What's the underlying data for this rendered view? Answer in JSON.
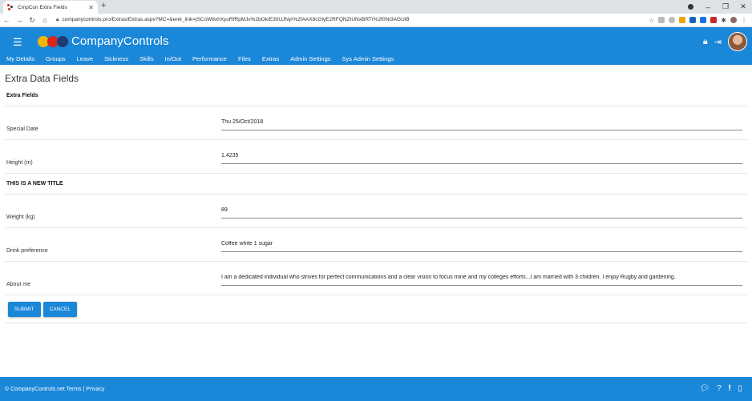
{
  "browser": {
    "tab_title": "CmpCon Extra Fields",
    "url": "companycontrols.pro/Extras/Extras.aspx?MC=&eret_link=jSCoW8xhXyuRfRpMJv%2bOk/E30UJNyr%2fAAX8cGlyE2RFQNZIUNxBRTr%2f0NI3AGUiB",
    "new_tab_symbol": "+",
    "icons": [
      "back-icon",
      "forward-icon",
      "reload-icon",
      "home-icon",
      "lock-icon",
      "star-icon",
      "profile-icon"
    ]
  },
  "app": {
    "brand": "CompanyControls",
    "menu": [
      "My Details",
      "Groups",
      "Leave",
      "Sickness",
      "Skills",
      "In/Out",
      "Performance",
      "Files",
      "Extras",
      "Admin Settings",
      "Sys Admin Settings"
    ]
  },
  "page": {
    "title": "Extra Data Fields",
    "section1": "Extra Fields",
    "special_date_label": "Special Date",
    "special_date_value": "Thu 25/Oct/2018",
    "height_label": "Height (m)",
    "height_value": "1.4235",
    "section2": "THIS IS A NEW TITLE",
    "weight_label": "Weight (kg)",
    "weight_value": "89",
    "drink_label": "Drink preference",
    "drink_value": "Coffee white 1 sugar",
    "about_label": "About me",
    "about_value": "I am a dedicated individual who strives for perfect communications and a clear vision to focus mine and my colleges efforts...I am married with 3 children. I enjoy Rugby and gardening.",
    "submit": "SUBMIT",
    "cancel": "CANCEL"
  },
  "footer": {
    "text": "© CompanyControls.net Terms | Privacy"
  },
  "colors": {
    "primary": "#1a87d9",
    "logo_yellow": "#f2b705",
    "logo_red": "#d9261c",
    "logo_navy": "#1f3b73"
  }
}
